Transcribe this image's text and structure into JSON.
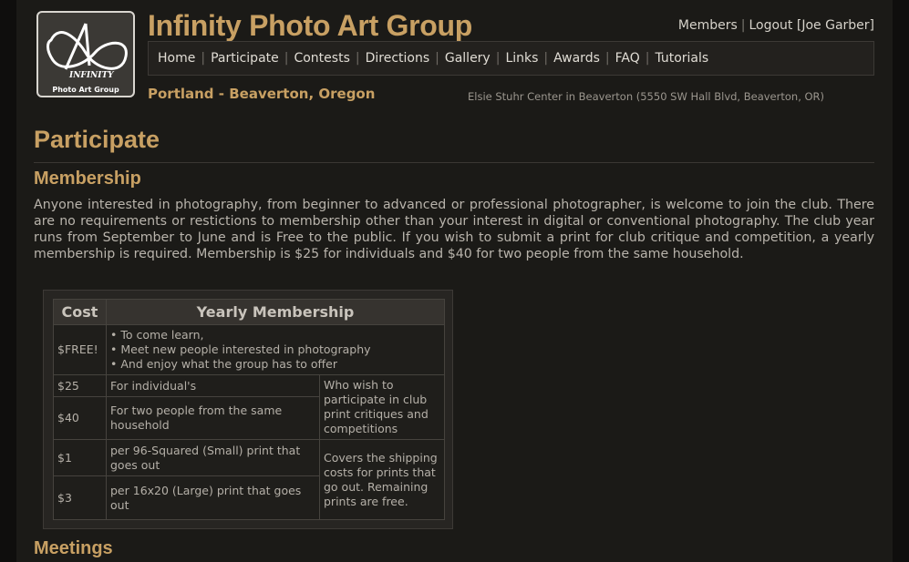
{
  "site": {
    "title": "Infinity Photo Art Group",
    "logo_text_1": "INFINITY",
    "logo_text_2": "Photo Art Group"
  },
  "userbar": {
    "members": "Members",
    "logout": "Logout",
    "user": "[Joe Garber]"
  },
  "nav": {
    "items": [
      "Home",
      "Participate",
      "Contests",
      "Directions",
      "Gallery",
      "Links",
      "Awards",
      "FAQ",
      "Tutorials"
    ]
  },
  "location": "Portland - Beaverton, Oregon",
  "venue": "Elsie Stuhr Center in Beaverton (5550 SW Hall Blvd, Beaverton, OR)",
  "page": {
    "title": "Participate",
    "section1": "Membership",
    "intro": "Anyone interested in photography, from beginner to advanced or professional photographer, is welcome to join the club. There are no requirements or restictions to membership other than your interest in digital or conventional photography. The club year runs from September to June and is Free to the public. If you wish to submit a print for club critique and competition, a yearly membership is required. Membership is $25 for individuals and $40 for two people from the same household.",
    "section2": "Meetings"
  },
  "table": {
    "headers": [
      "Cost",
      "Yearly Membership"
    ],
    "free_cost": "$FREE!",
    "free_items": [
      "To come learn,",
      "Meet new people interested in photography",
      "And enjoy what the group has to offer"
    ],
    "rows": [
      {
        "cost": "$25",
        "desc": "For individual's"
      },
      {
        "cost": "$40",
        "desc": "For two people from the same household"
      },
      {
        "cost": "$1",
        "desc": "per 96-Squared (Small) print that goes out"
      },
      {
        "cost": "$3",
        "desc": "per 16x20 (Large) print that goes out"
      }
    ],
    "note_membership": "Who wish to participate in club print critiques and competitions",
    "note_prints": "Covers the shipping costs for prints that go out. Remaining prints are free."
  }
}
